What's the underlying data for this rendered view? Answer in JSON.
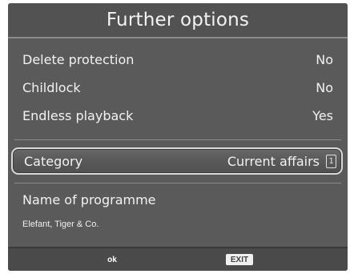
{
  "title": "Further options",
  "options": [
    {
      "label": "Delete protection",
      "value": "No"
    },
    {
      "label": "Childlock",
      "value": "No"
    },
    {
      "label": "Endless playback",
      "value": "Yes"
    }
  ],
  "category": {
    "label": "Category",
    "value": "Current affairs",
    "key_icon": "1"
  },
  "programme": {
    "label": "Name of programme",
    "value": "Elefant, Tiger & Co."
  },
  "footer": {
    "ok_label": "ok",
    "exit_label": "EXIT"
  }
}
